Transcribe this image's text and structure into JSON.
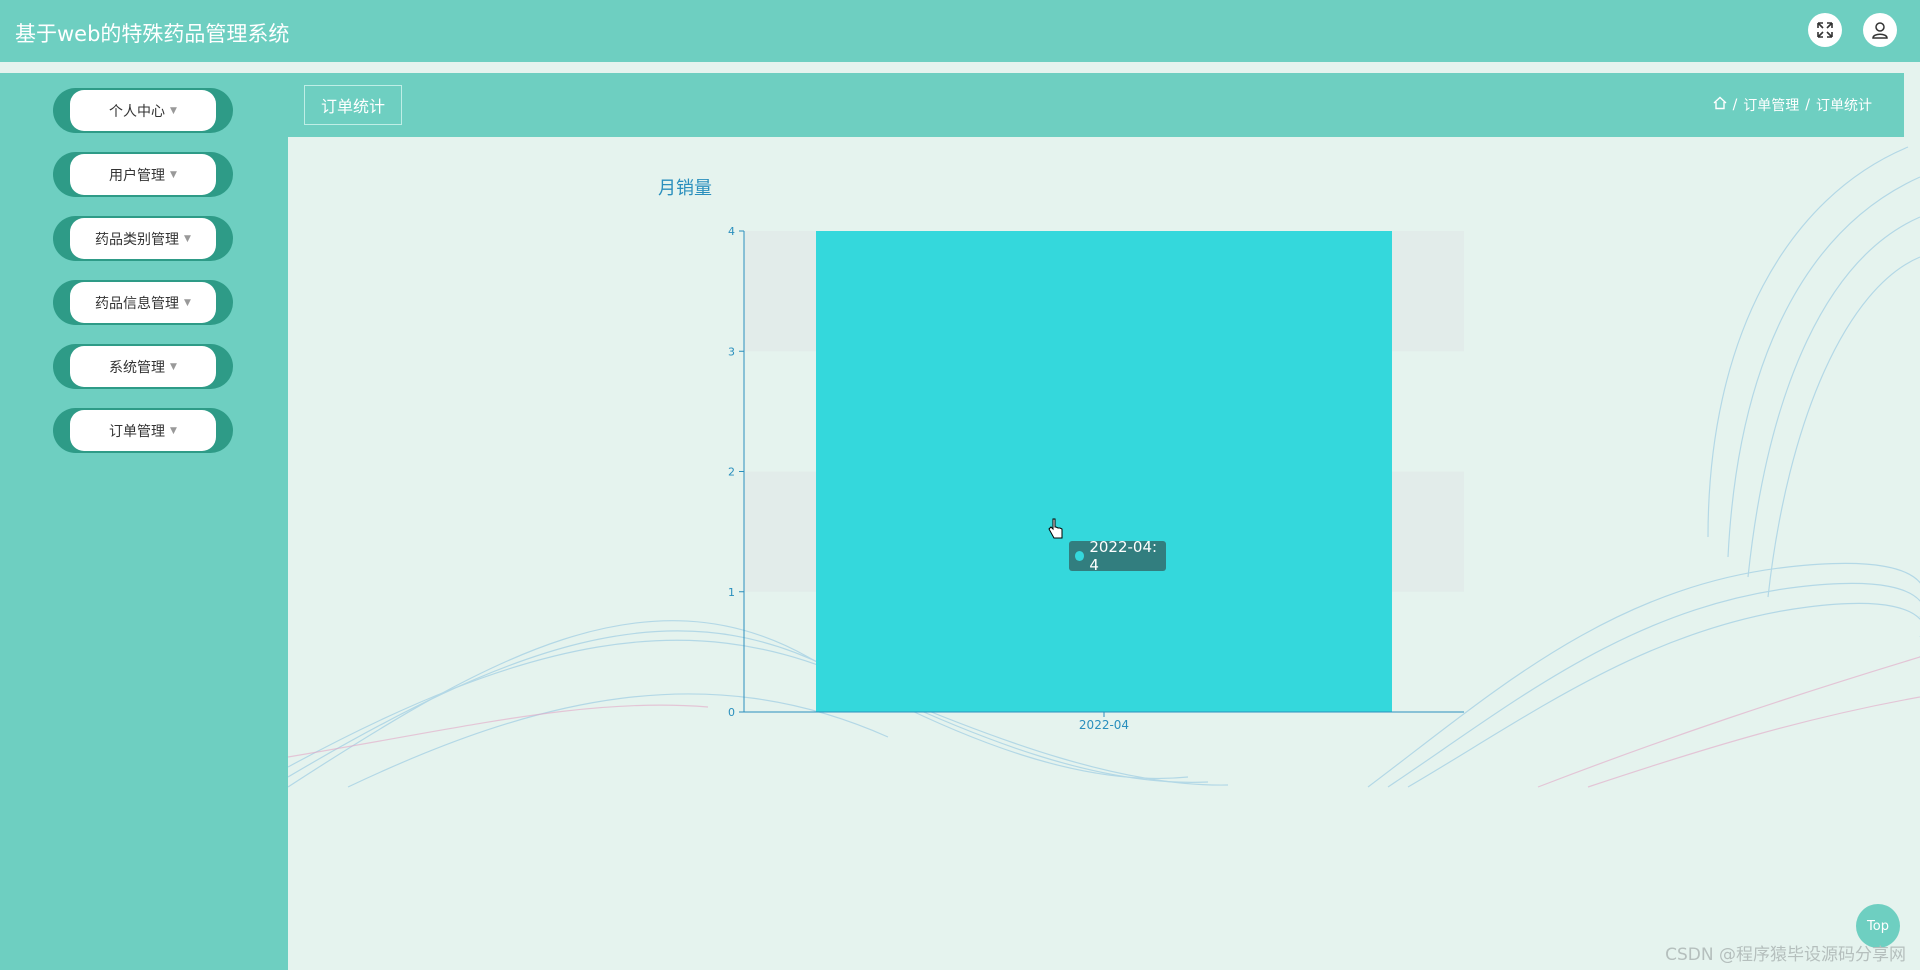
{
  "header": {
    "title": "基于web的特殊药品管理系统",
    "icons": [
      "fullscreen-icon",
      "user-icon"
    ]
  },
  "sidebar": {
    "items": [
      {
        "label": "个人中心"
      },
      {
        "label": "用户管理"
      },
      {
        "label": "药品类别管理"
      },
      {
        "label": "药品信息管理"
      },
      {
        "label": "系统管理"
      },
      {
        "label": "订单管理"
      }
    ]
  },
  "content": {
    "tab_label": "订单统计",
    "breadcrumb": [
      "订单管理",
      "订单统计"
    ],
    "breadcrumb_separator": "/"
  },
  "chart_data": {
    "type": "bar",
    "title": "月销量",
    "categories": [
      "2022-04"
    ],
    "values": [
      4
    ],
    "ylim": [
      0,
      4
    ],
    "yticks": [
      0,
      1,
      2,
      3,
      4
    ],
    "grid": "alternating bands",
    "bar_color": "#34d8dc",
    "tooltip": "2022-04: 4"
  },
  "top_button": "Top",
  "watermark": "CSDN @程序猿毕设源码分享网",
  "colors": {
    "primary": "#6ecfc1",
    "menu_accent": "#2e9b87",
    "background": "#e5f3ee",
    "axis": "#2a8fbd"
  }
}
